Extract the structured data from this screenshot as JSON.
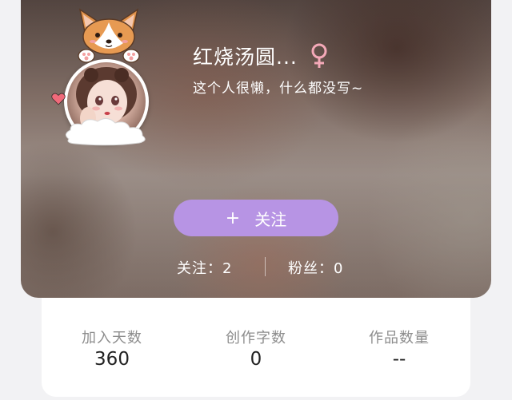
{
  "profile": {
    "username": "红烧汤圆...",
    "bio": "这个人很懒，什么都没写~",
    "gender_icon": "female-symbol-icon",
    "gender_color": "#f4a9b8"
  },
  "follow_button": {
    "icon": "+",
    "label": "关注",
    "color": "#b794e4"
  },
  "social_stats": {
    "following_label": "关注：",
    "following_value": "2",
    "fans_label": "粉丝：",
    "fans_value": "0"
  },
  "info_stats": [
    {
      "label": "加入天数",
      "value": "360"
    },
    {
      "label": "创作字数",
      "value": "0"
    },
    {
      "label": "作品数量",
      "value": "--"
    }
  ]
}
